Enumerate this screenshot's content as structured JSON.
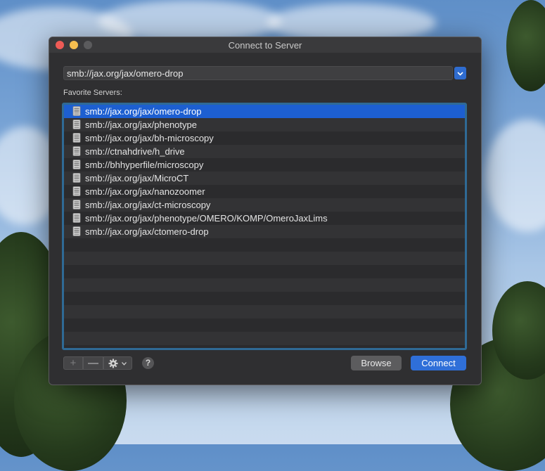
{
  "window": {
    "title": "Connect to Server"
  },
  "address": {
    "value": "smb://jax.org/jax/omero-drop"
  },
  "favorites": {
    "label": "Favorite Servers:",
    "items": [
      "smb://jax.org/jax/omero-drop",
      "smb://jax.org/jax/phenotype",
      "smb://jax.org/jax/bh-microscopy",
      "smb://ctnahdrive/h_drive",
      "smb://bhhyperfile/microscopy",
      "smb://jax.org/jax/MicroCT",
      "smb://jax.org/jax/nanozoomer",
      "smb://jax.org/jax/ct-microscopy",
      "smb://jax.org/jax/phenotype/OMERO/KOMP/OmeroJaxLims",
      "smb://jax.org/jax/ctomero-drop"
    ],
    "selected_index": 0
  },
  "toolbar": {
    "add_icon": "plus-icon",
    "remove_icon": "minus-icon",
    "action_icon": "gear-icon",
    "help_label": "?"
  },
  "buttons": {
    "browse_label": "Browse",
    "connect_label": "Connect"
  },
  "colors": {
    "accent": "#1d5fd1",
    "list_focus": "#2f6a95",
    "window_bg": "#2f2f31"
  }
}
